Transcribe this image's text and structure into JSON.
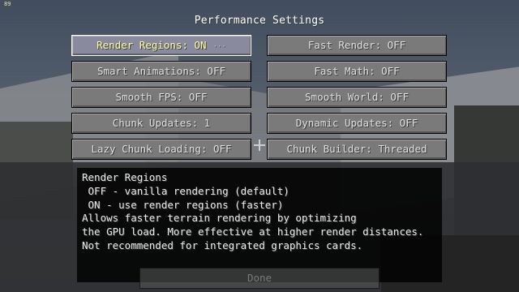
{
  "overlay": {
    "fps": "89"
  },
  "screen": {
    "title": "Performance Settings"
  },
  "buttons": {
    "left": [
      "Render Regions: ON",
      "Smart Animations: OFF",
      "Smooth FPS: OFF",
      "Chunk Updates: 1",
      "Lazy Chunk Loading: OFF"
    ],
    "right": [
      "Fast Render: OFF",
      "Fast Math: OFF",
      "Smooth World: OFF",
      "Dynamic Updates: OFF",
      "Chunk Builder: Threaded"
    ],
    "hover_indicator": "···",
    "done": "Done"
  },
  "tooltip": {
    "lines": [
      "Render Regions",
      " OFF - vanilla rendering (default)",
      " ON - use render regions (faster)",
      "Allows faster terrain rendering by optimizing",
      "the GPU load. More effective at higher render distances.",
      "Not recommended for integrated graphics cards."
    ]
  }
}
